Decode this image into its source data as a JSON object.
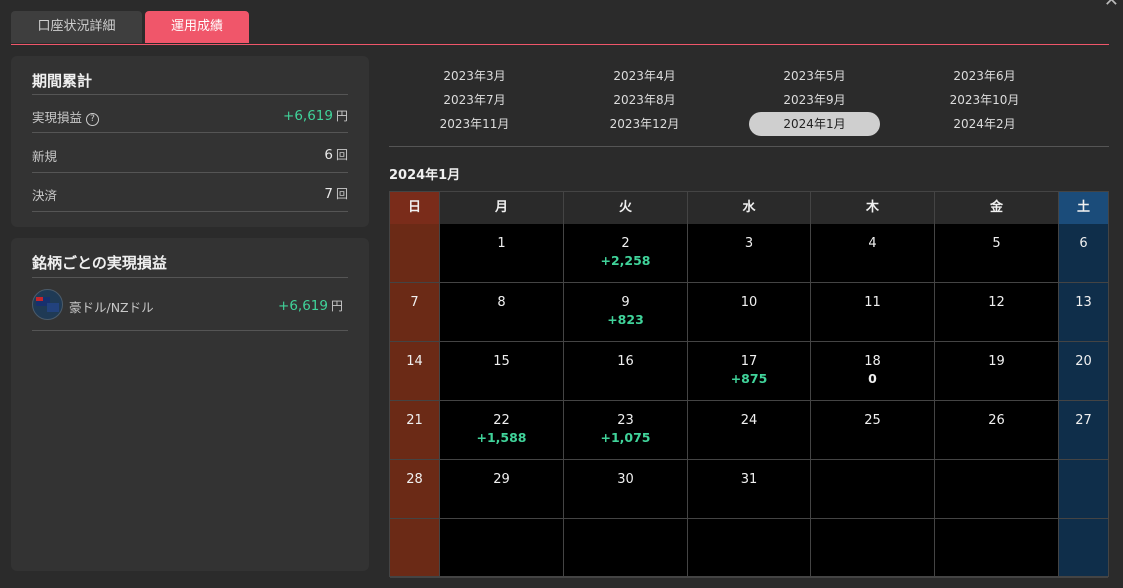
{
  "tabs": [
    {
      "label": "口座状況詳細",
      "active": false
    },
    {
      "label": "運用成績",
      "active": true
    }
  ],
  "summary": {
    "title": "期間累計",
    "rows": [
      {
        "label": "実現損益",
        "value": "+6,619",
        "unit": "円",
        "positive": true
      },
      {
        "label": "新規",
        "value": "6",
        "unit": "回",
        "positive": false
      },
      {
        "label": "決済",
        "value": "7",
        "unit": "回",
        "positive": false
      }
    ]
  },
  "symbols": {
    "title": "銘柄ごとの実現損益",
    "items": [
      {
        "name": "豪ドル/NZドル",
        "value": "+6,619",
        "unit": "円"
      }
    ]
  },
  "months": [
    "2023年3月",
    "2023年4月",
    "2023年5月",
    "2023年6月",
    "2023年7月",
    "2023年8月",
    "2023年9月",
    "2023年10月",
    "2023年11月",
    "2023年12月",
    "2024年1月",
    "2024年2月"
  ],
  "selected_month": "2024年1月",
  "calendar": {
    "title": "2024年1月",
    "weekdays": [
      "日",
      "月",
      "火",
      "水",
      "木",
      "金",
      "土"
    ],
    "weeks": [
      [
        {
          "d": ""
        },
        {
          "d": "1"
        },
        {
          "d": "2",
          "p": "+2,258"
        },
        {
          "d": "3"
        },
        {
          "d": "4"
        },
        {
          "d": "5"
        },
        {
          "d": "6"
        }
      ],
      [
        {
          "d": "7"
        },
        {
          "d": "8"
        },
        {
          "d": "9",
          "p": "+823"
        },
        {
          "d": "10"
        },
        {
          "d": "11"
        },
        {
          "d": "12"
        },
        {
          "d": "13"
        }
      ],
      [
        {
          "d": "14"
        },
        {
          "d": "15"
        },
        {
          "d": "16"
        },
        {
          "d": "17",
          "p": "+875"
        },
        {
          "d": "18",
          "p": "0"
        },
        {
          "d": "19"
        },
        {
          "d": "20"
        }
      ],
      [
        {
          "d": "21"
        },
        {
          "d": "22",
          "p": "+1,588"
        },
        {
          "d": "23",
          "p": "+1,075"
        },
        {
          "d": "24"
        },
        {
          "d": "25"
        },
        {
          "d": "26"
        },
        {
          "d": "27"
        }
      ],
      [
        {
          "d": "28"
        },
        {
          "d": "29"
        },
        {
          "d": "30"
        },
        {
          "d": "31"
        },
        {
          "d": ""
        },
        {
          "d": ""
        },
        {
          "d": ""
        }
      ],
      [
        {
          "d": ""
        },
        {
          "d": ""
        },
        {
          "d": ""
        },
        {
          "d": ""
        },
        {
          "d": ""
        },
        {
          "d": ""
        },
        {
          "d": ""
        }
      ]
    ]
  },
  "colors": {
    "accent": "#f0566a",
    "profit": "#40d39a",
    "sunday": "#7a2c1a",
    "saturday": "#1b4c7a"
  }
}
